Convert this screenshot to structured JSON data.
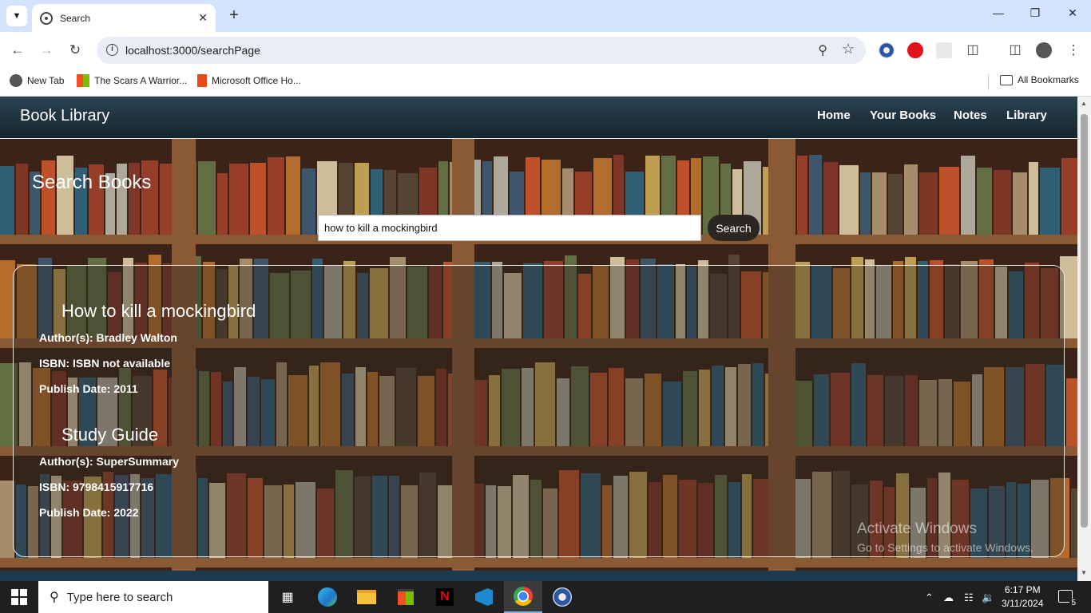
{
  "browser": {
    "tab_title": "Search",
    "url": "localhost:3000/searchPage",
    "bookmarks": [
      {
        "label": "New Tab",
        "icon": "globe-icon"
      },
      {
        "label": "The Scars A Warrior...",
        "icon": "windows-logo-icon"
      },
      {
        "label": "Microsoft Office Ho...",
        "icon": "office-icon"
      }
    ],
    "all_bookmarks_label": "All Bookmarks"
  },
  "site": {
    "brand": "Book Library",
    "nav": [
      "Home",
      "Your Books",
      "Notes",
      "Library"
    ],
    "page_title": "Search Books",
    "search_value": "how to kill a mockingbird",
    "search_button": "Search"
  },
  "results": [
    {
      "title": "How to kill a mockingbird",
      "authors": "Author(s): Bradley Walton",
      "isbn": "ISBN: ISBN not available",
      "publish_date": "Publish Date: 2011"
    },
    {
      "title": "Study Guide",
      "authors": "Author(s): SuperSummary",
      "isbn": "ISBN: 9798415917716",
      "publish_date": "Publish Date: 2022"
    }
  ],
  "watermark": {
    "line1": "Activate Windows",
    "line2": "Go to Settings to activate Windows."
  },
  "taskbar": {
    "search_placeholder": "Type here to search",
    "time": "6:17 PM",
    "date": "3/11/2024",
    "notification_count": "5"
  },
  "colors": {
    "nav_bar": "#1d303b",
    "tabstrip": "#d3e3fd",
    "search_button": "#2b2622",
    "taskbar": "#1f1f1f"
  }
}
